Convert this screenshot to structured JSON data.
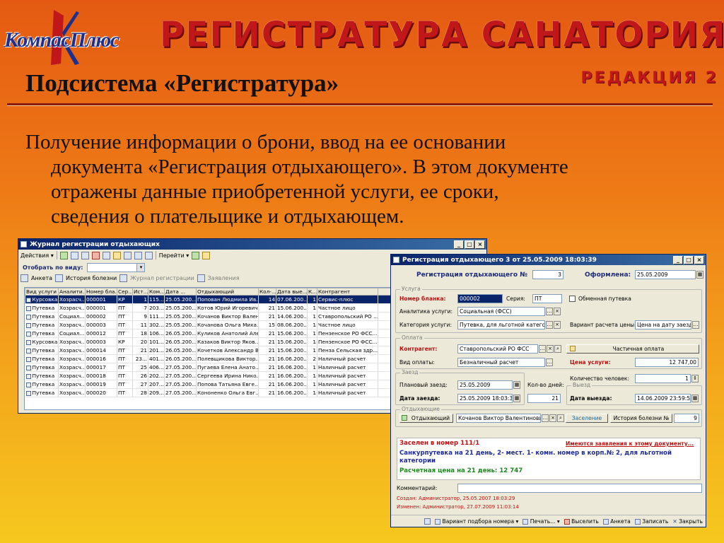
{
  "logo": {
    "brand": "КомпасПлюс"
  },
  "banner": {
    "title": "РЕГИСТРАТУРА САНАТОРИЯ",
    "edition": "РЕДАКЦИЯ 2"
  },
  "slide": {
    "title": "Подсистема «Регистратура»",
    "body_lines": [
      "Получение информации о брони, ввод на ее основании",
      "документа «Регистрация отдыхающего». В этом документе",
      "отражены данные приобретенной услуги, ее сроки,",
      "сведения о плательщике и отдыхающем."
    ]
  },
  "journal": {
    "title": "Журнал регистрации отдыхающих",
    "toolbar": {
      "actions": "Действия",
      "goto": "Перейти"
    },
    "filter_label": "Отобрать по виду:",
    "links": {
      "anketa": "Анкета",
      "history": "История болезни",
      "reg_journal": "Журнал регистрации",
      "requests": "Заявления"
    },
    "columns": [
      "Вид услуги",
      "Аналити...",
      "Номер бла...",
      "Сер...",
      "Ист...",
      "Ком...",
      "Дата ...",
      "Отдыхающий",
      "Кол-...",
      "Дата вые...",
      "К...",
      "Контрагент"
    ],
    "rows": [
      [
        "Курсовка",
        "Хозрасч...",
        "000001",
        "КР",
        "1",
        "115...",
        "25.05.200...",
        "Попован Людмила Ив...",
        "14",
        "07.06.200...",
        "1",
        "Сервис-плюс"
      ],
      [
        "Путевка",
        "Хозрасч...",
        "000001",
        "ПТ",
        "7",
        "203...",
        "25.05.200...",
        "Котов Юрий Игоревич",
        "21",
        "15.06.200...",
        "1",
        "Частное лицо"
      ],
      [
        "Путевка",
        "Социал...",
        "000002",
        "ПТ",
        "9",
        "111...",
        "25.05.200...",
        "Кочанов Виктор Вален...",
        "21",
        "14.06.200...",
        "1",
        "Ставропольский РО ..."
      ],
      [
        "Путевка",
        "Хозрасч...",
        "000003",
        "ПТ",
        "11",
        "302...",
        "25.05.200...",
        "Кочанова Ольга Миха...",
        "15",
        "08.06.200...",
        "1",
        "Частное лицо"
      ],
      [
        "Путевка",
        "Социал...",
        "000012",
        "ПТ",
        "18",
        "106...",
        "26.05.200...",
        "Куликов Анатолий Але...",
        "21",
        "15.06.200...",
        "1",
        "Пензенское РО ФСС..."
      ],
      [
        "Курсовка",
        "Хозрасч...",
        "000003",
        "КР",
        "20",
        "101...",
        "26.05.200...",
        "Казаков Виктор Яков...",
        "21",
        "15.06.200...",
        "1",
        "Пензенское РО ФСС..."
      ],
      [
        "Путевка",
        "Хозрасч...",
        "000014",
        "ПТ",
        "21",
        "201...",
        "26.05.200...",
        "Кочетков Александр В...",
        "21",
        "15.06.200...",
        "1",
        "Пенза Сельская здр..."
      ],
      [
        "Путевка",
        "Хозрасч...",
        "000016",
        "ПТ",
        "23...",
        "401...",
        "26.05.200...",
        "Полевщикова Виктор...",
        "21",
        "16.06.200...",
        "2",
        "Наличный расчет"
      ],
      [
        "Путевка",
        "Хозрасч...",
        "000017",
        "ПТ",
        "25",
        "406...",
        "27.05.200...",
        "Пугаева Елена Анато...",
        "21",
        "16.06.200...",
        "1",
        "Наличный расчет"
      ],
      [
        "Путевка",
        "Хозрасч...",
        "000018",
        "ПТ",
        "26",
        "202...",
        "27.05.200...",
        "Сергеева Ирина Нико...",
        "21",
        "16.06.200...",
        "1",
        "Наличный расчет"
      ],
      [
        "Путевка",
        "Хозрасч...",
        "000019",
        "ПТ",
        "27",
        "207...",
        "27.05.200...",
        "Попова Татьяна Евге...",
        "21",
        "16.06.200...",
        "1",
        "Наличный расчет"
      ],
      [
        "Путевка",
        "Хозрасч...",
        "000020",
        "ПТ",
        "28",
        "209...",
        "27.05.200...",
        "Кононенко Ольга Евг...",
        "21",
        "16.06.200...",
        "1",
        "Наличный расчет"
      ]
    ]
  },
  "regform": {
    "title": "Регистрация отдыхающего 3 от 25.05.2009 18:03:39",
    "header_label": "Регистрация отдыхающего №",
    "number": "3",
    "issued_label": "Оформлена:",
    "issued": "25.05.2009",
    "group_service": "Услуга",
    "blank_label": "Номер бланка:",
    "blank": "000002",
    "series_label": "Серия:",
    "series": "ПТ",
    "exchange_label": "Обменная путевка",
    "analytics_label": "Аналитика услуги:",
    "analytics": "Социальная (ФСС)",
    "category_label": "Категория услуги:",
    "category": "Путевка, для льготной катего",
    "calc_variant_label": "Вариант расчета цены:",
    "calc_variant": "Цена на дату заезд",
    "group_payment": "Оплата",
    "contractor_label": "Контрагент:",
    "contractor": "Ставропольский РО ФСС",
    "partial_pay": "Частичная оплата",
    "pay_kind_label": "Вид оплаты:",
    "pay_kind": "Безналичный расчет",
    "price_label": "Цена услуги:",
    "price": "12 747,00",
    "group_arrival": "Заезд",
    "planned_label": "Плановый заезд:",
    "planned": "25.05.2009",
    "days_label": "Кол-во дней:",
    "days": "21",
    "arrival_label": "Дата заезда:",
    "arrival": "25.05.2009 18:03:39",
    "persons_label": "Количество человек:",
    "persons": "1",
    "group_departure": "Выезд",
    "departure_label": "Дата выезда:",
    "departure": "14.06.2009 23:59:59",
    "group_guests": "Отдыхающие",
    "guest_btn": "Отдыхающий",
    "guest": "Кочанов Виктор Валентинович",
    "settle": "Заселение",
    "history_label": "История болезни №",
    "history": "9",
    "info_settled": "Заселен в номер 111/1",
    "info_link": "Имеются заявления к этому документу...",
    "info_voucher": "Санкурпутевка на 21 день, 2- мест. 1- комн. номер в корп.№ 2, для льготной категории",
    "info_price": "Расчетная цена на 21 день: 12 747",
    "comment_label": "Комментарий:",
    "created": "Создан: Администратор, 25.05.2007 18:03:29",
    "changed": "Изменен: Администратор, 27.07.2009 11:03:14",
    "bottom": {
      "variant": "Вариант подбора номера",
      "print": "Печать...",
      "evict": "Выселить",
      "anketa": "Анкета",
      "save": "Записать",
      "close": "Закрыть"
    }
  },
  "colors": {
    "accent_red": "#c0181a",
    "logo_blue": "#1f2f8c",
    "selection": "#0a246a",
    "info_green": "#1a8a1a"
  }
}
